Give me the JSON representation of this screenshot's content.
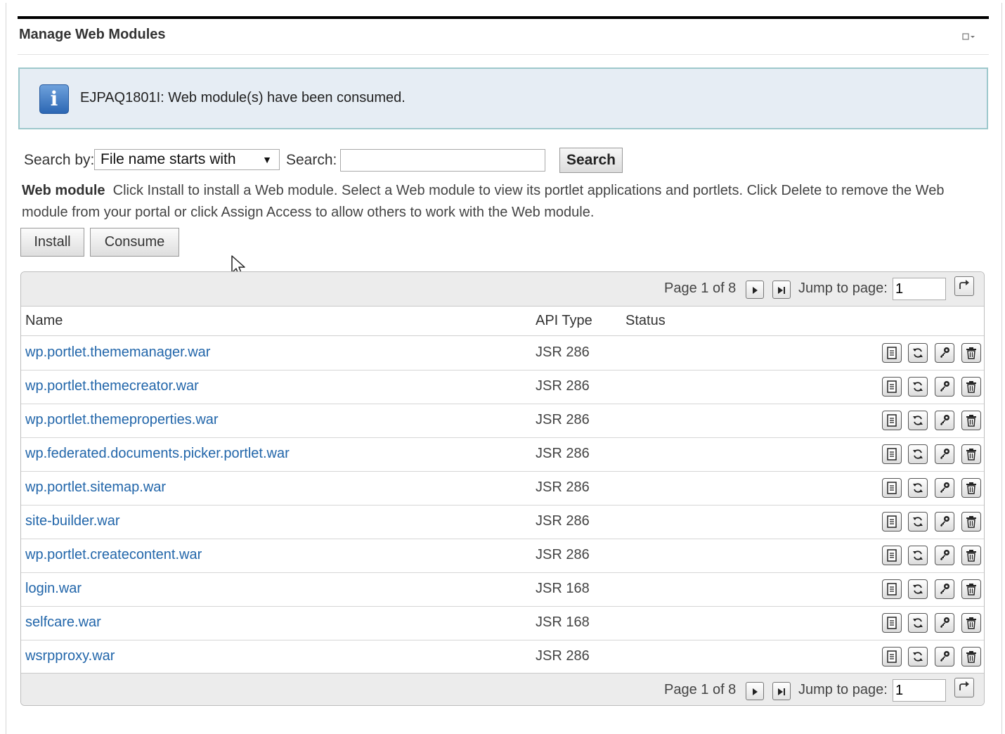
{
  "portlet": {
    "title": "Manage Web Modules"
  },
  "message": {
    "icon": "info-icon",
    "text": "EJPAQ1801I: Web module(s) have been consumed."
  },
  "search": {
    "by_label": "Search by:",
    "by_value": "File name starts with",
    "search_label": "Search:",
    "search_value": "",
    "button_label": "Search"
  },
  "description": {
    "heading": "Web module",
    "text": "Click Install to install a Web module. Select a Web module to view its portlet applications and portlets. Click Delete to remove the Web module from your portal or click Assign Access to allow others to work with the Web module."
  },
  "actions": {
    "install": "Install",
    "consume": "Consume"
  },
  "pagination": {
    "page_text": "Page 1 of 8",
    "current_page": 1,
    "total_pages": 8,
    "jump_label": "Jump to page:",
    "jump_value": "1"
  },
  "table": {
    "columns": [
      "Name",
      "API Type",
      "Status"
    ],
    "rows": [
      {
        "name": "wp.portlet.thememanager.war",
        "api": "JSR 286",
        "status": ""
      },
      {
        "name": "wp.portlet.themecreator.war",
        "api": "JSR 286",
        "status": ""
      },
      {
        "name": "wp.portlet.themeproperties.war",
        "api": "JSR 286",
        "status": ""
      },
      {
        "name": "wp.federated.documents.picker.portlet.war",
        "api": "JSR 286",
        "status": ""
      },
      {
        "name": "wp.portlet.sitemap.war",
        "api": "JSR 286",
        "status": ""
      },
      {
        "name": "site-builder.war",
        "api": "JSR 286",
        "status": ""
      },
      {
        "name": "wp.portlet.createcontent.war",
        "api": "JSR 286",
        "status": ""
      },
      {
        "name": "login.war",
        "api": "JSR 168",
        "status": ""
      },
      {
        "name": "selfcare.war",
        "api": "JSR 168",
        "status": ""
      },
      {
        "name": "wsrpproxy.war",
        "api": "JSR 286",
        "status": ""
      }
    ],
    "row_action_icons": [
      "details-icon",
      "update-icon",
      "assign-access-icon",
      "delete-icon"
    ]
  }
}
